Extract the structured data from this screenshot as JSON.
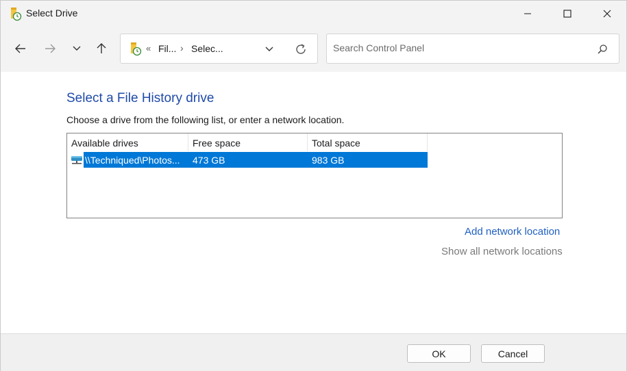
{
  "window": {
    "title": "Select Drive"
  },
  "address_bar": {
    "overflow_marker": "«",
    "crumbs": [
      "Fil...",
      "Selec..."
    ],
    "separator": "›"
  },
  "search": {
    "placeholder": "Search Control Panel",
    "value": ""
  },
  "content": {
    "heading": "Select a File History drive",
    "description": "Choose a drive from the following list, or enter a network location."
  },
  "drives_list": {
    "columns": [
      "Available drives",
      "Free space",
      "Total space"
    ],
    "rows": [
      {
        "drive": "\\\\Techniqued\\Photos...",
        "free_space": "473 GB",
        "total_space": "983 GB",
        "selected": true,
        "icon": "network-drive-icon"
      }
    ]
  },
  "links": {
    "add_network_location": "Add network location",
    "show_all_network_locations": "Show all network locations"
  },
  "buttons": {
    "ok": "OK",
    "cancel": "Cancel"
  },
  "colors": {
    "heading": "#1f4aa8",
    "selection": "#0078d7",
    "link": "#1f5fbf",
    "link_disabled": "#7a7a7a"
  }
}
